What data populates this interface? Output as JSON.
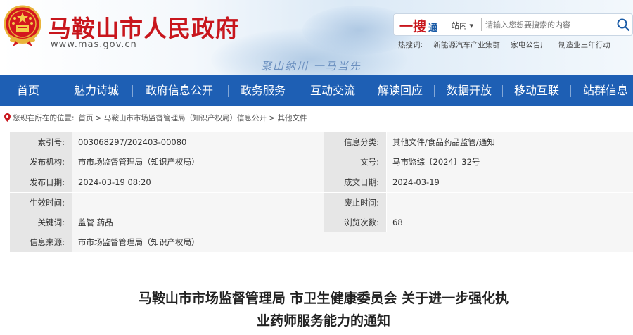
{
  "header": {
    "site_title": "马鞍山市人民政府",
    "site_url": "www.mas.gov.cn",
    "slogan": "聚山纳川 一马当先"
  },
  "search": {
    "logo_main": "一搜",
    "logo_sub": "通",
    "scope": "站内 ▾",
    "placeholder": "请输入您想要搜索的内容",
    "hot_label": "热搜词:",
    "hot_terms": [
      "新能源汽车产业集群",
      "家电公告厂",
      "制造业三年行动"
    ]
  },
  "nav": {
    "items": [
      "首页",
      "魅力诗城",
      "政府信息公开",
      "政务服务",
      "互动交流",
      "解读回应",
      "数据开放",
      "移动互联",
      "站群信息"
    ]
  },
  "breadcrumb": {
    "prefix": "您现在所在的位置:",
    "path": "首页 > 马鞍山市市场监督管理局（知识产权局）信息公开 > 其他文件"
  },
  "meta": {
    "rows": [
      {
        "l1": "索引号:",
        "v1": "003068297/202403-00080",
        "l2": "信息分类:",
        "v2": "其他文件/食品药品监管/通知"
      },
      {
        "l1": "发布机构:",
        "v1": "市市场监督管理局（知识产权局）",
        "l2": "文号:",
        "v2": "马市监综〔2024〕32号"
      },
      {
        "l1": "发布日期:",
        "v1": "2024-03-19  08:20",
        "l2": "成文日期:",
        "v2": "2024-03-19"
      },
      {
        "l1": "生效时间:",
        "v1": "",
        "l2": "废止时间:",
        "v2": ""
      },
      {
        "l1": "关键词:",
        "v1": "监管 药品",
        "l2": "浏览次数:",
        "v2": "68"
      }
    ],
    "source_label": "信息来源:",
    "source_value": "市市场监督管理局（知识产权局）"
  },
  "article": {
    "title_line1": "马鞍山市市场监督管理局 市卫生健康委员会 关于进一步强化执",
    "title_line2": "业药师服务能力的通知"
  },
  "colors": {
    "brand_red": "#c8161d",
    "nav_blue": "#1e5fb4",
    "label_bg": "#e6e6e6",
    "value_bg": "#f6f6f6"
  }
}
